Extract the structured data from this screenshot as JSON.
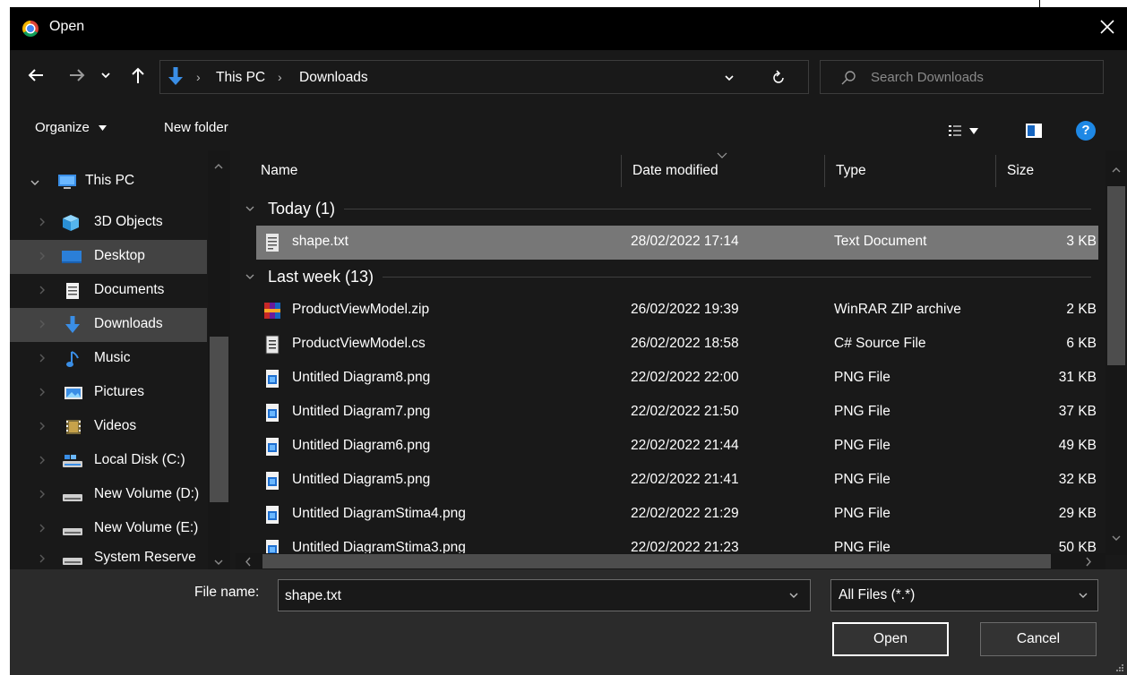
{
  "dialog": {
    "title": "Open",
    "app_icon": "chrome-icon",
    "close_icon": "close-icon"
  },
  "navigation": {
    "back_icon": "arrow-left-icon",
    "forward_icon": "arrow-right-icon",
    "recent_icon": "chevron-down-icon",
    "up_icon": "arrow-up-icon",
    "location_icon": "downloads-arrow-icon",
    "breadcrumbs": [
      "This PC",
      "Downloads"
    ],
    "search_placeholder": "Search Downloads"
  },
  "commands": {
    "organize": "Organize",
    "new_folder": "New folder",
    "view_icon": "view-options-icon",
    "preview_icon": "preview-pane-icon",
    "help_icon": "help-icon"
  },
  "tree": [
    {
      "label": "This PC",
      "icon": "this-pc-icon",
      "expanded": true
    },
    {
      "label": "3D Objects",
      "icon": "3d-objects-icon"
    },
    {
      "label": "Desktop",
      "icon": "desktop-icon",
      "selected": true
    },
    {
      "label": "Documents",
      "icon": "documents-icon"
    },
    {
      "label": "Downloads",
      "icon": "downloads-icon",
      "selected": true
    },
    {
      "label": "Music",
      "icon": "music-icon"
    },
    {
      "label": "Pictures",
      "icon": "pictures-icon"
    },
    {
      "label": "Videos",
      "icon": "videos-icon"
    },
    {
      "label": "Local Disk (C:)",
      "icon": "local-disk-icon"
    },
    {
      "label": "New Volume (D:)",
      "icon": "drive-icon"
    },
    {
      "label": "New Volume (E:)",
      "icon": "drive-icon"
    },
    {
      "label": "System Reserved",
      "icon": "drive-icon"
    }
  ],
  "columns": {
    "name": "Name",
    "date": "Date modified",
    "type": "Type",
    "size": "Size"
  },
  "groups": [
    {
      "label": "Today (1)",
      "rows": [
        {
          "name": "shape.txt",
          "date": "28/02/2022 17:14",
          "type": "Text Document",
          "size": "3 KB",
          "icon": "text-file-icon",
          "selected": true
        }
      ]
    },
    {
      "label": "Last week (13)",
      "rows": [
        {
          "name": "ProductViewModel.zip",
          "date": "26/02/2022 19:39",
          "type": "WinRAR ZIP archive",
          "size": "2 KB",
          "icon": "zip-archive-icon"
        },
        {
          "name": "ProductViewModel.cs",
          "date": "26/02/2022 18:58",
          "type": "C# Source File",
          "size": "6 KB",
          "icon": "source-file-icon"
        },
        {
          "name": "Untitled Diagram8.png",
          "date": "22/02/2022 22:00",
          "type": "PNG File",
          "size": "31 KB",
          "icon": "png-file-icon"
        },
        {
          "name": "Untitled Diagram7.png",
          "date": "22/02/2022 21:50",
          "type": "PNG File",
          "size": "37 KB",
          "icon": "png-file-icon"
        },
        {
          "name": "Untitled Diagram6.png",
          "date": "22/02/2022 21:44",
          "type": "PNG File",
          "size": "49 KB",
          "icon": "png-file-icon"
        },
        {
          "name": "Untitled Diagram5.png",
          "date": "22/02/2022 21:41",
          "type": "PNG File",
          "size": "32 KB",
          "icon": "png-file-icon"
        },
        {
          "name": "Untitled DiagramStima4.png",
          "date": "22/02/2022 21:29",
          "type": "PNG File",
          "size": "29 KB",
          "icon": "png-file-icon"
        },
        {
          "name": "Untitled DiagramStima3.png",
          "date": "22/02/2022 21:23",
          "type": "PNG File",
          "size": "50 KB",
          "icon": "png-file-icon"
        }
      ]
    }
  ],
  "footer": {
    "file_name_label": "File name:",
    "file_name_value": "shape.txt",
    "file_type_value": "All Files (*.*)",
    "open_label": "Open",
    "cancel_label": "Cancel"
  },
  "colors": {
    "background": "#191919",
    "titlebar": "#000000",
    "selected_row": "#777777",
    "selected_tree": "#434343",
    "accent": "#1e88e5"
  }
}
